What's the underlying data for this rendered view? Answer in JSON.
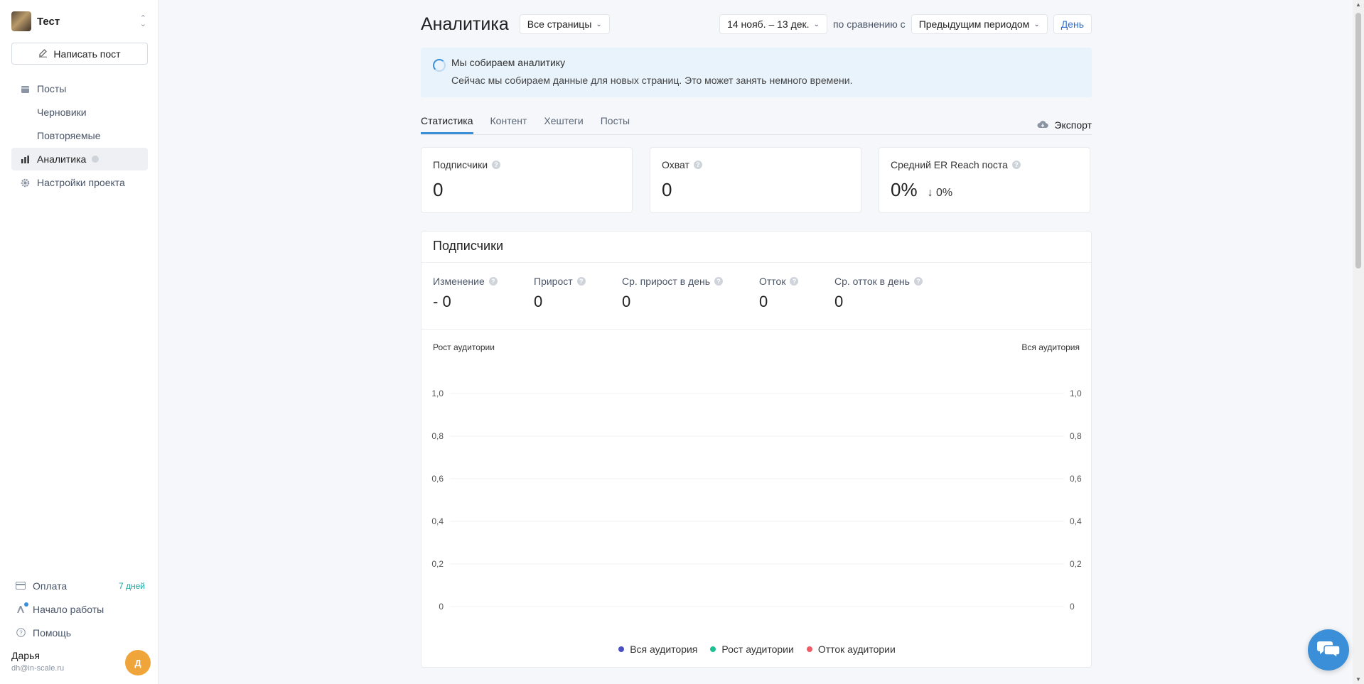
{
  "sidebar": {
    "project_name": "Тест",
    "write_post": "Написать пост",
    "nav": [
      {
        "label": "Посты",
        "icon": "calendar-icon"
      },
      {
        "label": "Черновики"
      },
      {
        "label": "Повторяемые"
      },
      {
        "label": "Аналитика",
        "icon": "bar-chart-icon"
      },
      {
        "label": "Настройки проекта",
        "icon": "gear-icon"
      }
    ],
    "billing": {
      "label": "Оплата",
      "trial": "7 дней"
    },
    "getting_started": "Начало работы",
    "help": "Помощь",
    "user": {
      "name": "Дарья",
      "email": "dh@in-scale.ru",
      "initial": "Д"
    }
  },
  "header": {
    "title": "Аналитика",
    "pages_filter": "Все страницы",
    "date_range": "14 нояб. – 13 дек.",
    "compare_label": "по сравнению с",
    "compare_period": "Предыдущим периодом",
    "granularity": "День"
  },
  "alert": {
    "title": "Мы собираем аналитику",
    "text": "Сейчас мы собираем данные для новых страниц. Это может занять немного времени."
  },
  "tabs": [
    "Статистика",
    "Контент",
    "Хештеги",
    "Посты"
  ],
  "export_label": "Экспорт",
  "cards": [
    {
      "label": "Подписчики",
      "value": "0"
    },
    {
      "label": "Охват",
      "value": "0"
    },
    {
      "label": "Средний ER Reach поста",
      "value": "0%",
      "change": "↓ 0%"
    }
  ],
  "subscribers_panel": {
    "title": "Подписчики",
    "stats": [
      {
        "label": "Изменение",
        "value": "- 0"
      },
      {
        "label": "Прирост",
        "value": "0"
      },
      {
        "label": "Ср. прирост в день",
        "value": "0"
      },
      {
        "label": "Отток",
        "value": "0"
      },
      {
        "label": "Ср. отток в день",
        "value": "0"
      }
    ]
  },
  "chart_data": {
    "type": "line",
    "xlabel": "",
    "ylabel_left": "Рост аудитории",
    "ylabel_right": "Вся аудитория",
    "ylim": [
      0,
      1
    ],
    "yticks": [
      "0",
      "0,2",
      "0,4",
      "0,6",
      "0,8",
      "1,0"
    ],
    "grid": true,
    "legend_position": "bottom",
    "series": [
      {
        "name": "Вся аудитория",
        "color": "#4a4fc4",
        "values": []
      },
      {
        "name": "Рост аудитории",
        "color": "#1fbf94",
        "values": []
      },
      {
        "name": "Отток аудитории",
        "color": "#ef5b66",
        "values": []
      }
    ]
  }
}
